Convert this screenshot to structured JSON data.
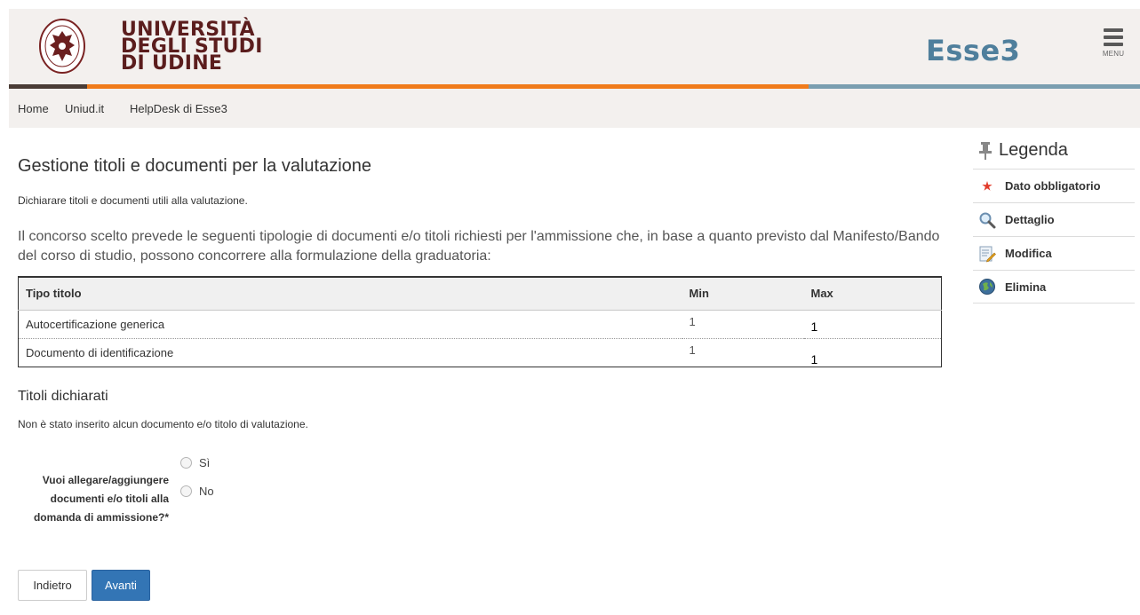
{
  "header": {
    "logo_lines": [
      "UNIVERSITÀ",
      "DEGLI STUDI",
      "DI UDINE"
    ],
    "app_name": "Esse3",
    "menu_label": "MENU"
  },
  "nav": {
    "links": [
      "Home",
      "Uniud.it",
      "HelpDesk di Esse3"
    ]
  },
  "main": {
    "title": "Gestione titoli e documenti per la valutazione",
    "intro": "Dichiarare titoli e documenti utili alla valutazione.",
    "lead": "Il concorso scelto prevede le seguenti tipologie di documenti e/o titoli richiesti per l'ammissione che, in base a quanto previsto dal Manifesto/Bando del corso di studio, possono concorrere alla formulazione della graduatoria:",
    "table": {
      "headers": [
        "Tipo titolo",
        "Min",
        "Max"
      ],
      "rows": [
        [
          "Autocertificazione generica",
          "1",
          "1"
        ],
        [
          "Documento di identificazione",
          "1",
          "1"
        ]
      ]
    },
    "declared_title": "Titoli dichiarati",
    "declared_empty": "Non è stato inserito alcun documento e/o titolo di valutazione.",
    "question": "Vuoi allegare/aggiungere documenti e/o titoli alla domanda di ammissione?*",
    "options": [
      "Sì",
      "No"
    ],
    "buttons": {
      "back": "Indietro",
      "next": "Avanti"
    }
  },
  "legend": {
    "title": "Legenda",
    "items": [
      {
        "label": "Dato obbligatorio",
        "icon": "asterisk-icon"
      },
      {
        "label": "Dettaglio",
        "icon": "magnifier-icon"
      },
      {
        "label": "Modifica",
        "icon": "edit-icon"
      },
      {
        "label": "Elimina",
        "icon": "delete-icon"
      }
    ]
  },
  "colors": {
    "brand_red": "#5b1d1d",
    "esse3_blue": "#4f7f9c",
    "orange_stripe": "#f07b1b",
    "primary_button": "#3375b5",
    "required_star": "#e23b2a"
  }
}
